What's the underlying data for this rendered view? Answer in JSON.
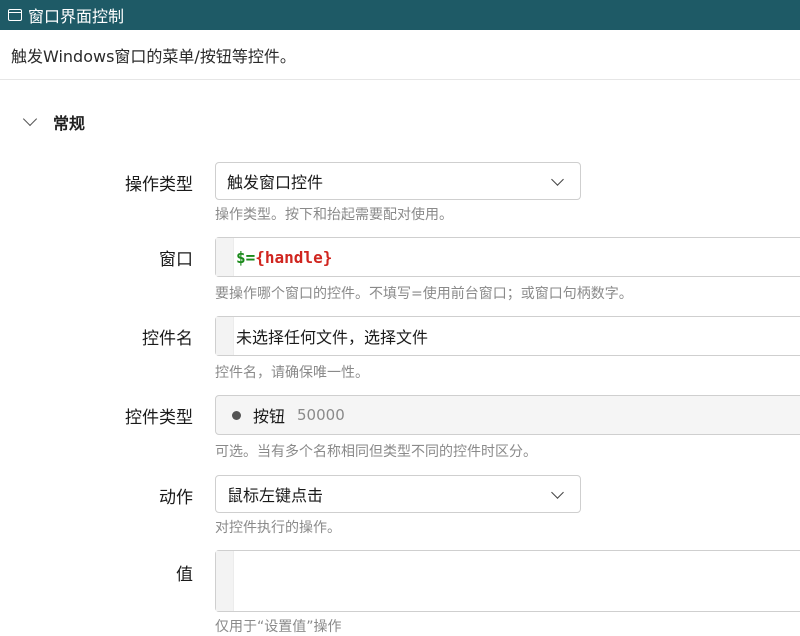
{
  "window": {
    "title": "窗口界面控制",
    "icon": "window-icon"
  },
  "description": "触发Windows窗口的菜单/按钮等控件。",
  "section": {
    "title": "常规",
    "expanded": true
  },
  "fields": {
    "operation_type": {
      "label": "操作类型",
      "value": "触发窗口控件",
      "hint": "操作类型。按下和抬起需要配对使用。"
    },
    "window_field": {
      "label": "窗口",
      "code_prefix": "$=",
      "code_var": "{handle}",
      "hint": "要操作哪个窗口的控件。不填写=使用前台窗口；或窗口句柄数字。"
    },
    "control_name": {
      "label": "控件名",
      "value": "未选择任何文件，选择文件",
      "hint": "控件名，请确保唯一性。"
    },
    "control_type": {
      "label": "控件类型",
      "value": "按钮",
      "code": "50000",
      "hint": "可选。当有多个名称相同但类型不同的控件时区分。"
    },
    "action": {
      "label": "动作",
      "value": "鼠标左键点击",
      "hint": "对控件执行的操作。"
    },
    "value_field": {
      "label": "值",
      "value": "",
      "hint": "仅用于“设置值”操作"
    }
  },
  "colors": {
    "titlebar": "#1e5a66",
    "code_dollar": "#1a8a1a",
    "code_var": "#d0251f"
  }
}
